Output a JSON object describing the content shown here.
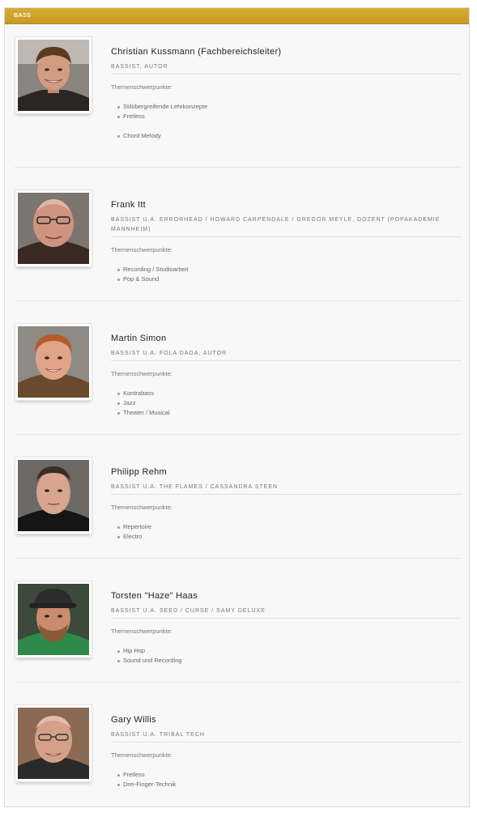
{
  "section": {
    "title": "BASS"
  },
  "people": [
    {
      "name": "Christian Kussmann (Fachbereichsleiter)",
      "role": "BASSIST, AUTOR",
      "focus_label": "Themenschwerpunkte:",
      "topics": [
        "Stilübergreifende Lehrkonzepte",
        "Fretless",
        "Chord Melody"
      ]
    },
    {
      "name": "Frank Itt",
      "role": "BASSIST U.A. ERRORHEAD / HOWARD CARPENDALE / GREGOR MEYLE, DOZENT (POPAKADEMIE MANNHEIM)",
      "focus_label": "Themenschwerpunkte:",
      "topics": [
        "Recording / Studioarbeit",
        "Pop & Sound"
      ]
    },
    {
      "name": "Martin Simon",
      "role": "BASSIST U.A. FOLA DADA, AUTOR",
      "focus_label": "Themenschwerpunkte:",
      "topics": [
        "Kontrabass",
        "Jazz",
        "Theater / Musical"
      ]
    },
    {
      "name": "Philipp Rehm",
      "role": "BASSIST U.A. THE FLAMES / CASSANDRA STEEN",
      "focus_label": "Themenschwerpunkte:",
      "topics": [
        "Repertoire",
        "Electro"
      ]
    },
    {
      "name": "Torsten \"Haze\" Haas",
      "role": "BASSIST U.A. SEED / CURSE / SAMY DELUXE",
      "focus_label": "Themenschwerpunkte:",
      "topics": [
        "Hip Hop",
        "Sound und Recording"
      ]
    },
    {
      "name": "Gary Willis",
      "role": "BASSIST U.A. TRIBAL TECH",
      "focus_label": "Themenschwerpunkte:",
      "topics": [
        "Fretless",
        "Drei-Finger-Technik"
      ]
    }
  ]
}
